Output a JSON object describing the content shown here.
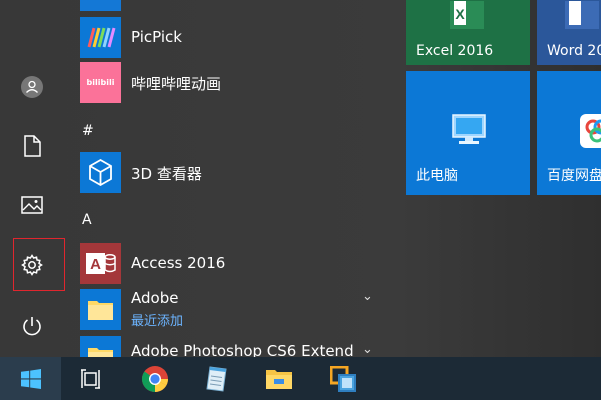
{
  "apps": {
    "picpick": "PicPick",
    "bilibili": "哔哩哔哩动画",
    "bilibili_icon_text": "bilibili",
    "header_hash": "#",
    "viewer3d": "3D 查看器",
    "header_a": "A",
    "access": "Access 2016",
    "adobe": "Adobe",
    "adobe_sub": "最近添加",
    "photoshop": "Adobe Photoshop CS6 Extend"
  },
  "tiles": {
    "excel": "Excel 2016",
    "word": "Word 20",
    "this_pc": "此电脑",
    "baidu": "百度网盘"
  },
  "rail": {
    "icons": [
      "user-icon",
      "document-icon",
      "pictures-icon",
      "settings-icon",
      "power-icon"
    ]
  },
  "taskbar": {
    "icons": [
      "windows-start-icon",
      "task-view-icon",
      "chrome-icon",
      "notepad-icon",
      "file-explorer-icon",
      "vmware-icon"
    ]
  },
  "colors": {
    "tile_blue": "#0c78d6",
    "excel_green": "#1e7145",
    "selection_red": "#e0262e",
    "recent_link": "#6cb4ff",
    "taskbar": "#1c2a36"
  }
}
